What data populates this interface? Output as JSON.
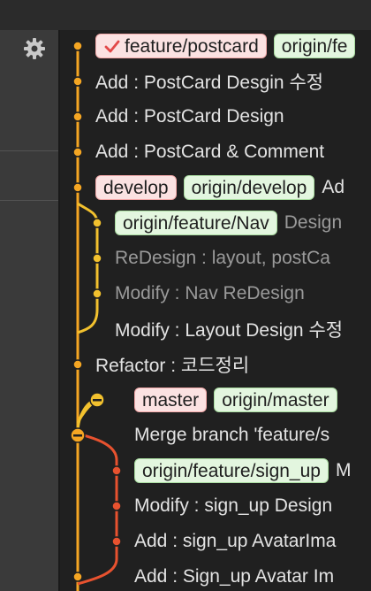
{
  "colors": {
    "lane_main": "#f5a623",
    "lane_feature_nav": "#f2c12e",
    "lane_master": "#f2c12e",
    "lane_signup": "#e8522f",
    "tag_local_bg": "#fbe2e2",
    "tag_remote_bg": "#e3f6df"
  },
  "sidebar": {
    "settings_icon": "gear-icon"
  },
  "commits": [
    {
      "local_branch": "feature/postcard",
      "remote_branch": "origin/fe",
      "message": "",
      "checked_out": true
    },
    {
      "message": "Add :  PostCard Desgin 수정"
    },
    {
      "message": "Add : PostCard Design"
    },
    {
      "message": "Add : PostCard & Comment"
    },
    {
      "local_branch": "develop",
      "remote_branch": "origin/develop",
      "message": "Ad"
    },
    {
      "remote_branch": "origin/feature/Nav",
      "message": "Design"
    },
    {
      "message": "ReDesign : layout, postCa"
    },
    {
      "message": "Modify : Nav ReDesign"
    },
    {
      "message": "Modify : Layout Design 수정"
    },
    {
      "message": "Refactor : 코드정리"
    },
    {
      "local_branch": "master",
      "remote_branch": "origin/master",
      "message": ""
    },
    {
      "message": "Merge branch 'feature/s"
    },
    {
      "remote_branch": "origin/feature/sign_up",
      "message": "M"
    },
    {
      "message": "Modify : sign_up Design"
    },
    {
      "message": "Add : sign_up AvatarIma"
    },
    {
      "message": "Add : Sign_up Avatar Im"
    }
  ]
}
